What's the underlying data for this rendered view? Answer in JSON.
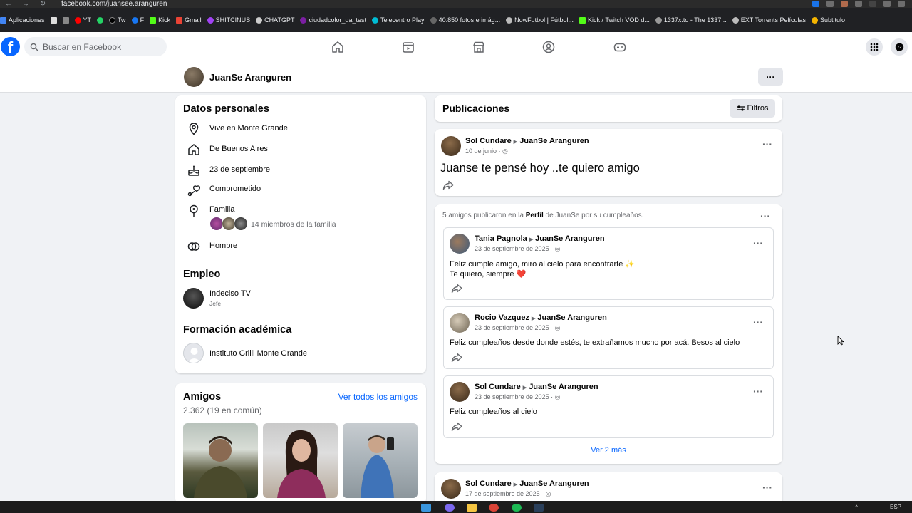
{
  "browser": {
    "url": "facebook.com/juansee.aranguren",
    "bookmarks": [
      "Aplicaciones",
      "YT",
      "Tw",
      "F",
      "Kick",
      "Gmail",
      "SHITCINUS",
      "CHATGPT",
      "ciudadcolor_qa_test",
      "Telecentro Play",
      "40.850 fotos e imág...",
      "NowFutbol | Fútbol...",
      "Kick / Twitch VOD d...",
      "1337x.to - The 1337...",
      "EXT Torrents Películas",
      "Subtitulo"
    ],
    "colors": {
      "chrome": "#202124"
    }
  },
  "header": {
    "logo": "f",
    "search_placeholder": "Buscar en Facebook",
    "nav_icons": [
      "home-icon",
      "video-icon",
      "marketplace-icon",
      "groups-icon",
      "gaming-icon"
    ],
    "accent": "#0866ff"
  },
  "profile": {
    "name": "JuanSe Aranguren",
    "more": "···"
  },
  "personal": {
    "title": "Datos personales",
    "lives": "Vive en Monte Grande",
    "from": "De Buenos Aires",
    "birthday": "23 de septiembre",
    "relationship": "Comprometido",
    "family_label": "Familia",
    "family_count": "14 miembros de la familia",
    "gender": "Hombre"
  },
  "work": {
    "title": "Empleo",
    "company": "Indeciso TV",
    "role": "Jefe"
  },
  "education": {
    "title": "Formación académica",
    "school": "Instituto Grilli Monte Grande"
  },
  "friends": {
    "title": "Amigos",
    "see_all": "Ver todos los amigos",
    "count": "2.362 (19 en común)"
  },
  "publications": {
    "title": "Publicaciones",
    "filters": "Filtros"
  },
  "post1": {
    "author": "Sol Cundare",
    "target": "JuanSe Aranguren",
    "date": "10 de junio · ",
    "text": "Juanse te pensé hoy ..te quiero amigo"
  },
  "birthday_group": {
    "summary_pre": "5 amigos publicaron en la ",
    "summary_bold": "Perfil",
    "summary_post": " de JuanSe por su cumpleaños.",
    "see_more": "Ver 2 más",
    "posts": [
      {
        "author": "Tania Pagnola",
        "target": "JuanSe Aranguren",
        "date": "23 de septiembre de 2025 · ",
        "line1": "Feliz cumple amigo, miro al cielo para encontrarte ✨",
        "line2": "Te quiero, siempre ❤️"
      },
      {
        "author": "Rocio Vazquez",
        "target": "JuanSe Aranguren",
        "date": "23 de septiembre de 2025 · ",
        "line1": "Feliz cumpleaños desde donde estés, te extrañamos mucho por acá. Besos al cielo"
      },
      {
        "author": "Sol Cundare",
        "target": "JuanSe Aranguren",
        "date": "23 de septiembre de 2025 · ",
        "line1": "Feliz cumpleaños al cielo"
      }
    ]
  },
  "post_last": {
    "author": "Sol Cundare",
    "target": "JuanSe Aranguren",
    "date": "17 de septiembre de 2025 · "
  },
  "taskbar": {
    "lang": "ESP"
  }
}
